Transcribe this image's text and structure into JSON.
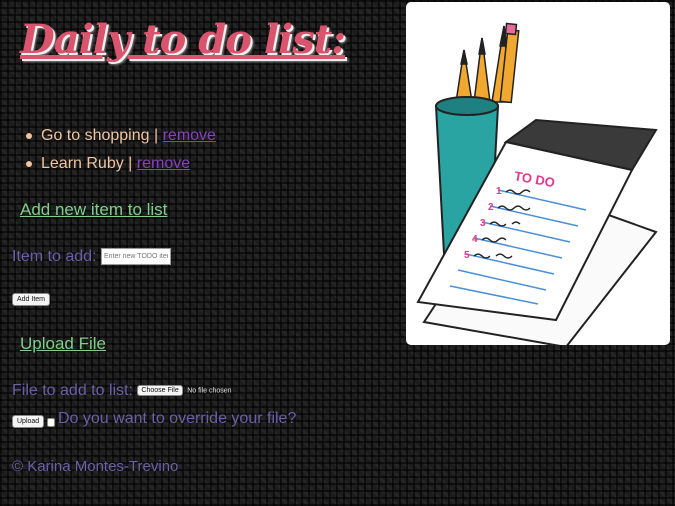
{
  "header": {
    "title": "Daily to do list:"
  },
  "todos": [
    {
      "text": "Go to shopping",
      "separator": "|",
      "remove_label": "remove"
    },
    {
      "text": "Learn Ruby",
      "separator": "|",
      "remove_label": "remove"
    }
  ],
  "add_section": {
    "heading": "Add new item to list",
    "item_label": "Item to add:",
    "item_placeholder": "Enter new TODO item",
    "button_label": "Add Item"
  },
  "upload_section": {
    "heading": "Upload File",
    "file_label": "File to add to list:",
    "choose_label": "Choose File",
    "no_file_text": "No file chosen",
    "upload_button": "Upload",
    "override_label": "Do you want to override your file?"
  },
  "footer": {
    "text": "© Karina Montes-Trevino"
  },
  "illustration": {
    "notepad_heading": "TO DO"
  },
  "colors": {
    "title": "#d9546c",
    "link_green": "#7fce8a",
    "link_purple": "#8a3fc0",
    "label_purple": "#6a5fa8",
    "todo_text": "#f0c4a0"
  }
}
